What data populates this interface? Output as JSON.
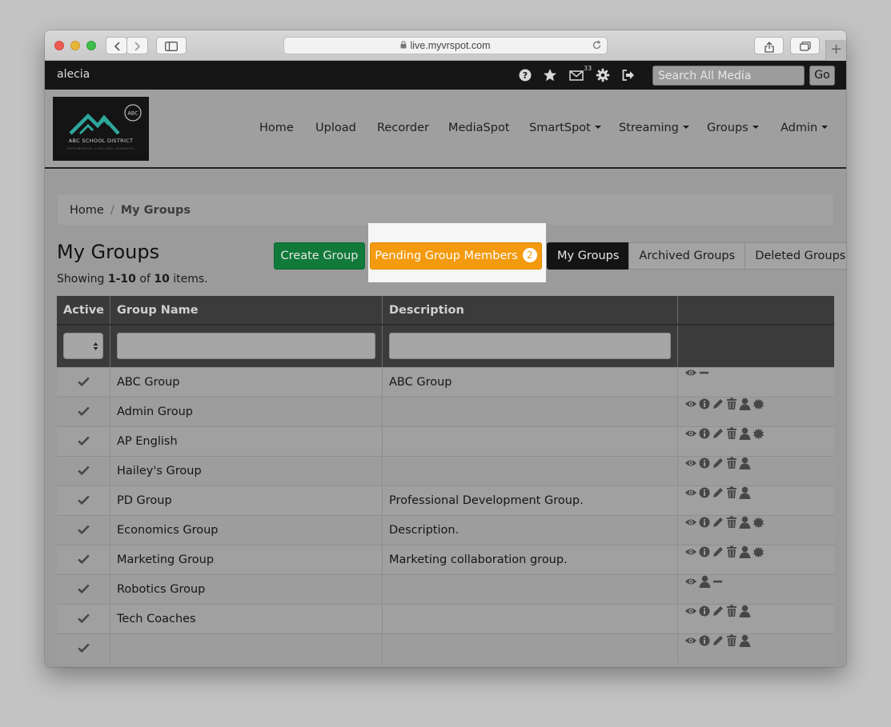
{
  "browser": {
    "url": "live.myvrspot.com"
  },
  "topbar": {
    "username": "alecia",
    "mail_count": "33",
    "search_placeholder": "Search All Media",
    "go_label": "Go"
  },
  "logo": {
    "badge": "ABC",
    "name": "ABC SCHOOL DISTRICT",
    "tagline": "EMPOWERING LIFELONG LEARNERS"
  },
  "nav": [
    {
      "label": "Home"
    },
    {
      "label": "Upload"
    },
    {
      "label": "Recorder"
    },
    {
      "label": "MediaSpot"
    },
    {
      "label": "SmartSpot"
    },
    {
      "label": "Streaming"
    },
    {
      "label": "Groups"
    },
    {
      "label": "Admin"
    }
  ],
  "breadcrumb": {
    "home": "Home",
    "separator": "/",
    "current": "My Groups"
  },
  "page": {
    "title": "My Groups",
    "showing_prefix": "Showing ",
    "showing_range": "1-10",
    "showing_of": " of ",
    "showing_total": "10",
    "showing_suffix": " items."
  },
  "buttons": {
    "create_group": "Create Group",
    "pending_members": "Pending Group Members",
    "pending_count": "2"
  },
  "views": {
    "my_groups": "My Groups",
    "archived_groups": "Archived Groups",
    "deleted_groups": "Deleted Groups"
  },
  "table": {
    "headers": {
      "active": "Active",
      "group_name": "Group Name",
      "description": "Description",
      "actions": ""
    },
    "rows": [
      {
        "name": "ABC Group",
        "description": "ABC Group"
      },
      {
        "name": "Admin Group",
        "description": ""
      },
      {
        "name": "AP English",
        "description": ""
      },
      {
        "name": "Hailey's Group",
        "description": ""
      },
      {
        "name": "PD Group",
        "description": "Professional Development Group."
      },
      {
        "name": "Economics Group",
        "description": "Description."
      },
      {
        "name": "Marketing Group",
        "description": "Marketing collaboration group."
      },
      {
        "name": "Robotics Group",
        "description": ""
      },
      {
        "name": "Tech Coaches",
        "description": ""
      },
      {
        "name": "",
        "description": ""
      }
    ]
  },
  "colors": {
    "topbar_bg": "#161616",
    "create_button": "#117a3a",
    "pending_button": "#f39a0e",
    "active_view": "#141414"
  }
}
